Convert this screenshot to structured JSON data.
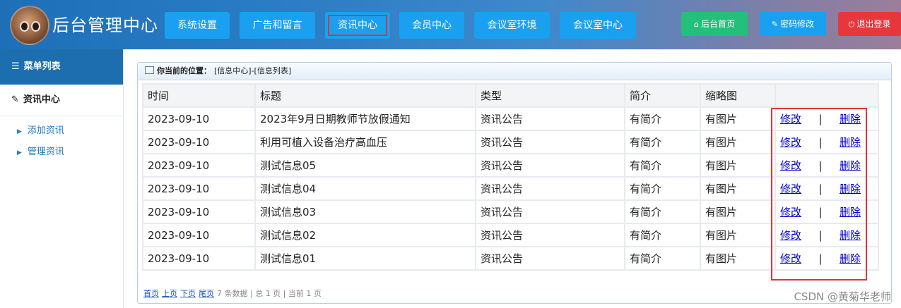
{
  "header": {
    "title": "后台管理中心",
    "nav": [
      "系统设置",
      "广告和留言",
      "资讯中心",
      "会员中心",
      "会议室环境",
      "会议室中心"
    ],
    "active_nav": "资讯中心",
    "right_buttons": [
      {
        "label": "后台首页",
        "icon": "home-icon",
        "color": "#22c07a"
      },
      {
        "label": "密码修改",
        "icon": "wrench-icon",
        "color": "#1aa0f0"
      },
      {
        "label": "退出登录",
        "icon": "power-icon",
        "color": "#e8363d"
      }
    ]
  },
  "sidebar": {
    "heading": "菜单列表",
    "section": "资讯中心",
    "items": [
      "添加资讯",
      "管理资讯"
    ],
    "active_item": "管理资讯"
  },
  "breadcrumb": {
    "label": "你当前的位置：",
    "path": "[信息中心]-[信息列表]"
  },
  "table": {
    "headers": [
      "时间",
      "标题",
      "类型",
      "简介",
      "缩略图",
      ""
    ],
    "rows": [
      [
        "2023-09-10",
        "2023年9月日期教师节放假通知",
        "资讯公告",
        "有简介",
        "有图片"
      ],
      [
        "2023-09-10",
        "利用可植入设备治疗高血压",
        "资讯公告",
        "有简介",
        "有图片"
      ],
      [
        "2023-09-10",
        "测试信息05",
        "资讯公告",
        "有简介",
        "有图片"
      ],
      [
        "2023-09-10",
        "测试信息04",
        "资讯公告",
        "有简介",
        "有图片"
      ],
      [
        "2023-09-10",
        "测试信息03",
        "资讯公告",
        "有简介",
        "有图片"
      ],
      [
        "2023-09-10",
        "测试信息02",
        "资讯公告",
        "有简介",
        "有图片"
      ],
      [
        "2023-09-10",
        "测试信息01",
        "资讯公告",
        "有简介",
        "有图片"
      ]
    ],
    "edit_label": "修改",
    "delete_label": "删除",
    "separator": "|"
  },
  "pager": {
    "first": "首页",
    "prev": "上页",
    "next": "下页",
    "last": "尾页",
    "info": "7 条数据 | 总 1 页 | 当前 1 页"
  },
  "watermark": "CSDN @黄菊华老师",
  "colors": {
    "highlight": "#e0333a",
    "nav_button": "#1aa0f0",
    "sidebar_head": "#1c6eae",
    "link": "#0000cc"
  }
}
